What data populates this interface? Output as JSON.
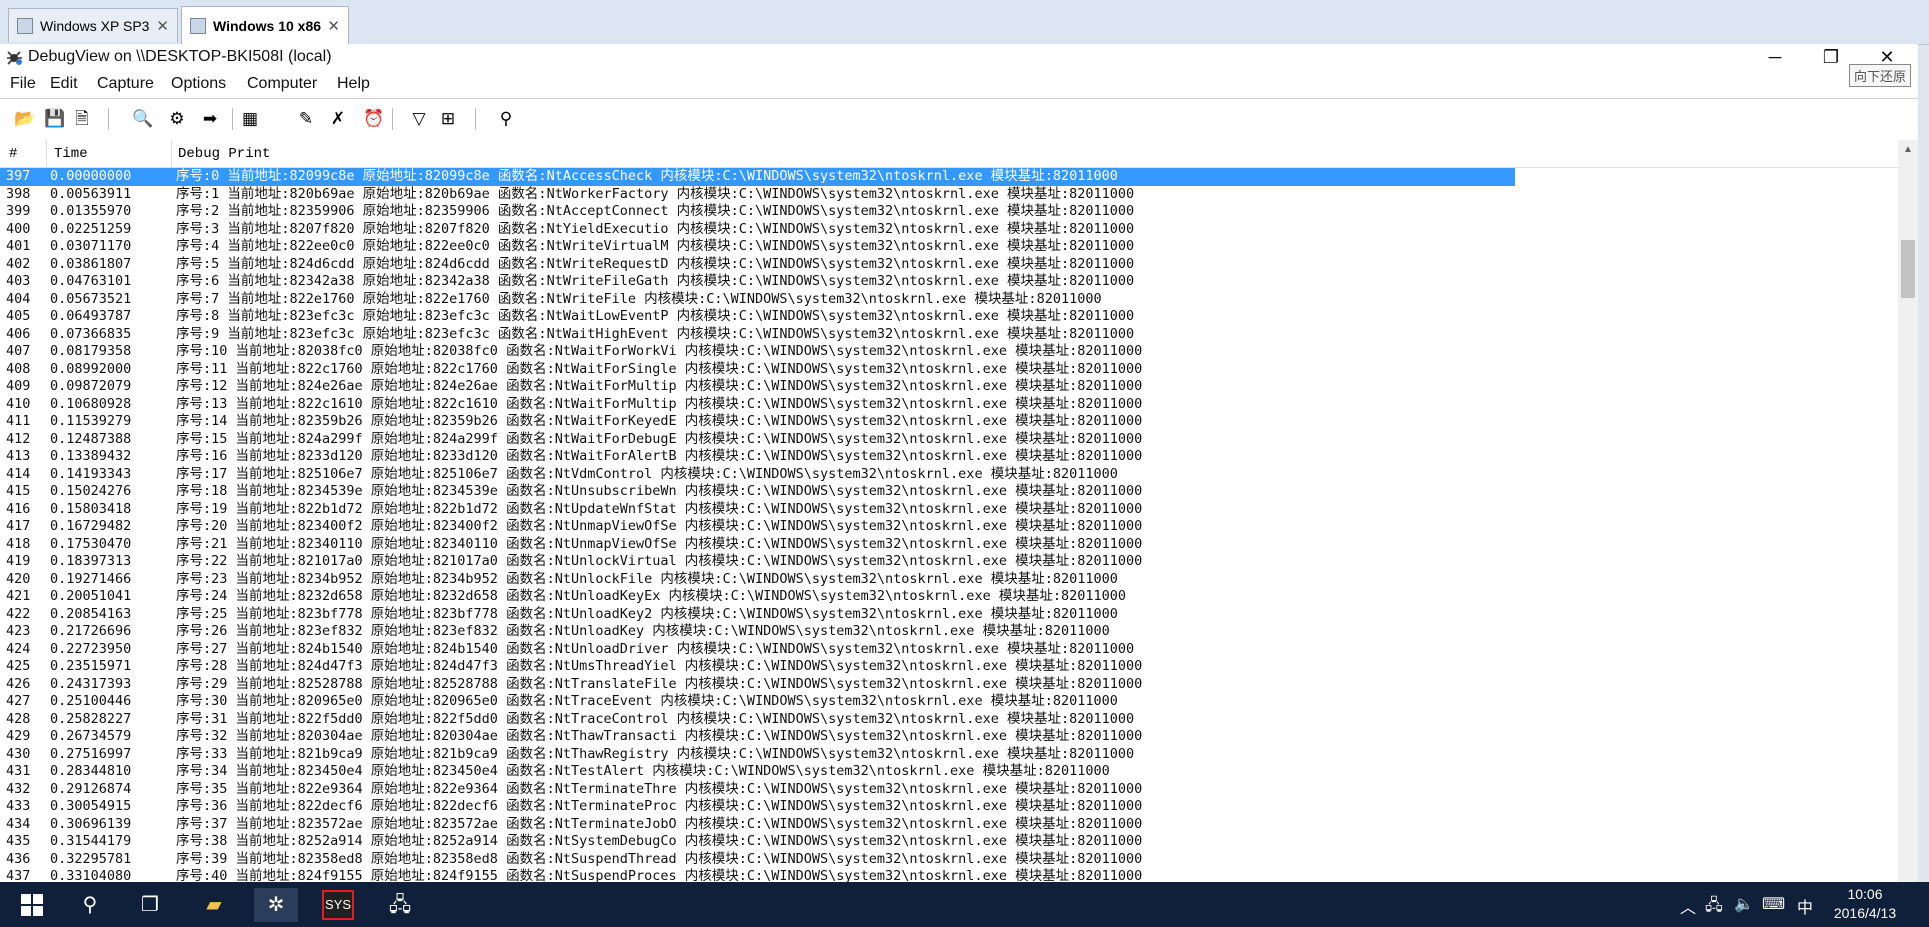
{
  "vm_tabs": [
    {
      "label": "Windows XP SP3",
      "active": false
    },
    {
      "label": "Windows 10 x86",
      "active": true
    }
  ],
  "window": {
    "title": "DebugView on \\\\DESKTOP-BKI508I (local)",
    "tooltip": "向下还原",
    "minimize_glyph": "─",
    "restore_glyph": "❐",
    "close_glyph": "✕"
  },
  "menu": [
    "File",
    "Edit",
    "Capture",
    "Options",
    "Computer",
    "Help"
  ],
  "toolbar_icons": [
    {
      "name": "open-icon",
      "glyph": "📂"
    },
    {
      "name": "save-icon",
      "glyph": "💾"
    },
    {
      "name": "clear-save-icon",
      "glyph": "🗎"
    },
    {
      "name": "find-icon",
      "glyph": "🔍"
    },
    {
      "name": "capture-icon",
      "glyph": "⚙"
    },
    {
      "name": "arrow-right-icon",
      "glyph": "➡"
    },
    {
      "name": "capture-kernel-icon",
      "glyph": "▦"
    },
    {
      "name": "edit-icon",
      "glyph": "✎"
    },
    {
      "name": "clear-display-icon",
      "glyph": "✗"
    },
    {
      "name": "clock-icon",
      "glyph": "⏰"
    },
    {
      "name": "filter-icon",
      "glyph": "▽"
    },
    {
      "name": "highlight-icon",
      "glyph": "⊞"
    },
    {
      "name": "binoculars-icon",
      "glyph": "⚲"
    }
  ],
  "columns": [
    "#",
    "Time",
    "Debug Print"
  ],
  "rows": [
    {
      "n": "397",
      "t": "0.00000000",
      "p": "序号:0 当前地址:82099c8e 原始地址:82099c8e 函数名:NtAccessCheck 内核模块:C:\\WINDOWS\\system32\\ntoskrnl.exe 模块基址:82011000"
    },
    {
      "n": "398",
      "t": "0.00563911",
      "p": "序号:1 当前地址:820b69ae 原始地址:820b69ae 函数名:NtWorkerFactory 内核模块:C:\\WINDOWS\\system32\\ntoskrnl.exe 模块基址:82011000"
    },
    {
      "n": "399",
      "t": "0.01355970",
      "p": "序号:2 当前地址:82359906 原始地址:82359906 函数名:NtAcceptConnect 内核模块:C:\\WINDOWS\\system32\\ntoskrnl.exe 模块基址:82011000"
    },
    {
      "n": "400",
      "t": "0.02251259",
      "p": "序号:3 当前地址:8207f820 原始地址:8207f820 函数名:NtYieldExecutio 内核模块:C:\\WINDOWS\\system32\\ntoskrnl.exe 模块基址:82011000"
    },
    {
      "n": "401",
      "t": "0.03071170",
      "p": "序号:4 当前地址:822ee0c0 原始地址:822ee0c0 函数名:NtWriteVirtualM 内核模块:C:\\WINDOWS\\system32\\ntoskrnl.exe 模块基址:82011000"
    },
    {
      "n": "402",
      "t": "0.03861807",
      "p": "序号:5 当前地址:824d6cdd 原始地址:824d6cdd 函数名:NtWriteRequestD 内核模块:C:\\WINDOWS\\system32\\ntoskrnl.exe 模块基址:82011000"
    },
    {
      "n": "403",
      "t": "0.04763101",
      "p": "序号:6 当前地址:82342a38 原始地址:82342a38 函数名:NtWriteFileGath 内核模块:C:\\WINDOWS\\system32\\ntoskrnl.exe 模块基址:82011000"
    },
    {
      "n": "404",
      "t": "0.05673521",
      "p": "序号:7 当前地址:822e1760 原始地址:822e1760 函数名:NtWriteFile 内核模块:C:\\WINDOWS\\system32\\ntoskrnl.exe 模块基址:82011000"
    },
    {
      "n": "405",
      "t": "0.06493787",
      "p": "序号:8 当前地址:823efc3c 原始地址:823efc3c 函数名:NtWaitLowEventP 内核模块:C:\\WINDOWS\\system32\\ntoskrnl.exe 模块基址:82011000"
    },
    {
      "n": "406",
      "t": "0.07366835",
      "p": "序号:9 当前地址:823efc3c 原始地址:823efc3c 函数名:NtWaitHighEvent 内核模块:C:\\WINDOWS\\system32\\ntoskrnl.exe 模块基址:82011000"
    },
    {
      "n": "407",
      "t": "0.08179358",
      "p": "序号:10 当前地址:82038fc0 原始地址:82038fc0 函数名:NtWaitForWorkVi 内核模块:C:\\WINDOWS\\system32\\ntoskrnl.exe 模块基址:82011000"
    },
    {
      "n": "408",
      "t": "0.08992000",
      "p": "序号:11 当前地址:822c1760 原始地址:822c1760 函数名:NtWaitForSingle 内核模块:C:\\WINDOWS\\system32\\ntoskrnl.exe 模块基址:82011000"
    },
    {
      "n": "409",
      "t": "0.09872079",
      "p": "序号:12 当前地址:824e26ae 原始地址:824e26ae 函数名:NtWaitForMultip 内核模块:C:\\WINDOWS\\system32\\ntoskrnl.exe 模块基址:82011000"
    },
    {
      "n": "410",
      "t": "0.10680928",
      "p": "序号:13 当前地址:822c1610 原始地址:822c1610 函数名:NtWaitForMultip 内核模块:C:\\WINDOWS\\system32\\ntoskrnl.exe 模块基址:82011000"
    },
    {
      "n": "411",
      "t": "0.11539279",
      "p": "序号:14 当前地址:82359b26 原始地址:82359b26 函数名:NtWaitForKeyedE 内核模块:C:\\WINDOWS\\system32\\ntoskrnl.exe 模块基址:82011000"
    },
    {
      "n": "412",
      "t": "0.12487388",
      "p": "序号:15 当前地址:824a299f 原始地址:824a299f 函数名:NtWaitForDebugE 内核模块:C:\\WINDOWS\\system32\\ntoskrnl.exe 模块基址:82011000"
    },
    {
      "n": "413",
      "t": "0.13389432",
      "p": "序号:16 当前地址:8233d120 原始地址:8233d120 函数名:NtWaitForAlertB 内核模块:C:\\WINDOWS\\system32\\ntoskrnl.exe 模块基址:82011000"
    },
    {
      "n": "414",
      "t": "0.14193343",
      "p": "序号:17 当前地址:825106e7 原始地址:825106e7 函数名:NtVdmControl 内核模块:C:\\WINDOWS\\system32\\ntoskrnl.exe 模块基址:82011000"
    },
    {
      "n": "415",
      "t": "0.15024276",
      "p": "序号:18 当前地址:8234539e 原始地址:8234539e 函数名:NtUnsubscribeWn 内核模块:C:\\WINDOWS\\system32\\ntoskrnl.exe 模块基址:82011000"
    },
    {
      "n": "416",
      "t": "0.15803418",
      "p": "序号:19 当前地址:822b1d72 原始地址:822b1d72 函数名:NtUpdateWnfStat 内核模块:C:\\WINDOWS\\system32\\ntoskrnl.exe 模块基址:82011000"
    },
    {
      "n": "417",
      "t": "0.16729482",
      "p": "序号:20 当前地址:823400f2 原始地址:823400f2 函数名:NtUnmapViewOfSe 内核模块:C:\\WINDOWS\\system32\\ntoskrnl.exe 模块基址:82011000"
    },
    {
      "n": "418",
      "t": "0.17530470",
      "p": "序号:21 当前地址:82340110 原始地址:82340110 函数名:NtUnmapViewOfSe 内核模块:C:\\WINDOWS\\system32\\ntoskrnl.exe 模块基址:82011000"
    },
    {
      "n": "419",
      "t": "0.18397313",
      "p": "序号:22 当前地址:821017a0 原始地址:821017a0 函数名:NtUnlockVirtual 内核模块:C:\\WINDOWS\\system32\\ntoskrnl.exe 模块基址:82011000"
    },
    {
      "n": "420",
      "t": "0.19271466",
      "p": "序号:23 当前地址:8234b952 原始地址:8234b952 函数名:NtUnlockFile 内核模块:C:\\WINDOWS\\system32\\ntoskrnl.exe 模块基址:82011000"
    },
    {
      "n": "421",
      "t": "0.20051041",
      "p": "序号:24 当前地址:8232d658 原始地址:8232d658 函数名:NtUnloadKeyEx 内核模块:C:\\WINDOWS\\system32\\ntoskrnl.exe 模块基址:82011000"
    },
    {
      "n": "422",
      "t": "0.20854163",
      "p": "序号:25 当前地址:823bf778 原始地址:823bf778 函数名:NtUnloadKey2 内核模块:C:\\WINDOWS\\system32\\ntoskrnl.exe 模块基址:82011000"
    },
    {
      "n": "423",
      "t": "0.21726696",
      "p": "序号:26 当前地址:823ef832 原始地址:823ef832 函数名:NtUnloadKey 内核模块:C:\\WINDOWS\\system32\\ntoskrnl.exe 模块基址:82011000"
    },
    {
      "n": "424",
      "t": "0.22723950",
      "p": "序号:27 当前地址:824b1540 原始地址:824b1540 函数名:NtUnloadDriver 内核模块:C:\\WINDOWS\\system32\\ntoskrnl.exe 模块基址:82011000"
    },
    {
      "n": "425",
      "t": "0.23515971",
      "p": "序号:28 当前地址:824d47f3 原始地址:824d47f3 函数名:NtUmsThreadYiel 内核模块:C:\\WINDOWS\\system32\\ntoskrnl.exe 模块基址:82011000"
    },
    {
      "n": "426",
      "t": "0.24317393",
      "p": "序号:29 当前地址:82528788 原始地址:82528788 函数名:NtTranslateFile 内核模块:C:\\WINDOWS\\system32\\ntoskrnl.exe 模块基址:82011000"
    },
    {
      "n": "427",
      "t": "0.25100446",
      "p": "序号:30 当前地址:820965e0 原始地址:820965e0 函数名:NtTraceEvent 内核模块:C:\\WINDOWS\\system32\\ntoskrnl.exe 模块基址:82011000"
    },
    {
      "n": "428",
      "t": "0.25828227",
      "p": "序号:31 当前地址:822f5dd0 原始地址:822f5dd0 函数名:NtTraceControl 内核模块:C:\\WINDOWS\\system32\\ntoskrnl.exe 模块基址:82011000"
    },
    {
      "n": "429",
      "t": "0.26734579",
      "p": "序号:32 当前地址:820304ae 原始地址:820304ae 函数名:NtThawTransacti 内核模块:C:\\WINDOWS\\system32\\ntoskrnl.exe 模块基址:82011000"
    },
    {
      "n": "430",
      "t": "0.27516997",
      "p": "序号:33 当前地址:821b9ca9 原始地址:821b9ca9 函数名:NtThawRegistry 内核模块:C:\\WINDOWS\\system32\\ntoskrnl.exe 模块基址:82011000"
    },
    {
      "n": "431",
      "t": "0.28344810",
      "p": "序号:34 当前地址:823450e4 原始地址:823450e4 函数名:NtTestAlert 内核模块:C:\\WINDOWS\\system32\\ntoskrnl.exe 模块基址:82011000"
    },
    {
      "n": "432",
      "t": "0.29126874",
      "p": "序号:35 当前地址:822e9364 原始地址:822e9364 函数名:NtTerminateThre 内核模块:C:\\WINDOWS\\system32\\ntoskrnl.exe 模块基址:82011000"
    },
    {
      "n": "433",
      "t": "0.30054915",
      "p": "序号:36 当前地址:822decf6 原始地址:822decf6 函数名:NtTerminateProc 内核模块:C:\\WINDOWS\\system32\\ntoskrnl.exe 模块基址:82011000"
    },
    {
      "n": "434",
      "t": "0.30696139",
      "p": "序号:37 当前地址:823572ae 原始地址:823572ae 函数名:NtTerminateJobO 内核模块:C:\\WINDOWS\\system32\\ntoskrnl.exe 模块基址:82011000"
    },
    {
      "n": "435",
      "t": "0.31544179",
      "p": "序号:38 当前地址:8252a914 原始地址:8252a914 函数名:NtSystemDebugCo 内核模块:C:\\WINDOWS\\system32\\ntoskrnl.exe 模块基址:82011000"
    },
    {
      "n": "436",
      "t": "0.32295781",
      "p": "序号:39 当前地址:82358ed8 原始地址:82358ed8 函数名:NtSuspendThread 内核模块:C:\\WINDOWS\\system32\\ntoskrnl.exe 模块基址:82011000"
    },
    {
      "n": "437",
      "t": "0.33104080",
      "p": "序号:40 当前地址:824f9155 原始地址:824f9155 函数名:NtSuspendProces 内核模块:C:\\WINDOWS\\system32\\ntoskrnl.exe 模块基址:82011000"
    }
  ],
  "selected_row": "397",
  "taskbar": {
    "sys_label": "SYS",
    "clock_time": "10:06",
    "clock_date": "2016/4/13",
    "ime": "中"
  },
  "colors": {
    "selection": "#3399ff",
    "taskbar": "#10203a"
  }
}
